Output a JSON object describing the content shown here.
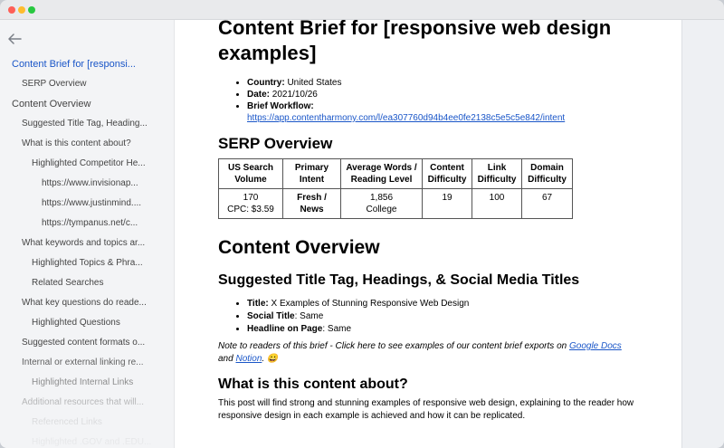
{
  "sidebar": {
    "items": [
      {
        "label": "Content Brief for [responsi...",
        "level": 0,
        "active": true
      },
      {
        "label": "SERP Overview",
        "level": 1
      },
      {
        "label": "Content Overview",
        "level": 0
      },
      {
        "label": "Suggested Title Tag, Heading...",
        "level": 1
      },
      {
        "label": "What is this content about?",
        "level": 1
      },
      {
        "label": "Highlighted Competitor He...",
        "level": 2
      },
      {
        "label": "https://www.invisionap...",
        "level": 3
      },
      {
        "label": "https://www.justinmind....",
        "level": 3
      },
      {
        "label": "https://tympanus.net/c...",
        "level": 3
      },
      {
        "label": "What keywords and topics ar...",
        "level": 1
      },
      {
        "label": "Highlighted Topics & Phra...",
        "level": 2
      },
      {
        "label": "Related Searches",
        "level": 2
      },
      {
        "label": "What key questions do reade...",
        "level": 1
      },
      {
        "label": "Highlighted Questions",
        "level": 2
      },
      {
        "label": "Suggested content formats o...",
        "level": 1
      },
      {
        "label": "Internal or external linking re...",
        "level": 1
      },
      {
        "label": "Highlighted Internal Links",
        "level": 2
      },
      {
        "label": "Additional resources that will...",
        "level": 1
      },
      {
        "label": "Referenced Links",
        "level": 2
      },
      {
        "label": "Highlighted .GOV and .EDU...",
        "level": 2
      }
    ]
  },
  "doc": {
    "title": "Content Brief for [responsive web design examples]",
    "meta": {
      "country_label": "Country:",
      "country_value": "United States",
      "date_label": "Date:",
      "date_value": "2021/10/26",
      "workflow_label": "Brief Workflow:",
      "workflow_link": "https://app.contentharmony.com/l/ea307760d94b4ee0fe2138c5e5c5e842/intent"
    },
    "serp_heading": "SERP Overview",
    "serp_table": {
      "headers": [
        "US Search Volume",
        "Primary Intent",
        "Average Words / Reading Level",
        "Content Difficulty",
        "Link Difficulty",
        "Domain Difficulty"
      ],
      "row": {
        "volume": "170",
        "cpc": "CPC: $3.59",
        "intent_1": "Fresh /",
        "intent_2": "News",
        "words": "1,856",
        "level": "College",
        "content_difficulty": "19",
        "link_difficulty": "100",
        "domain_difficulty": "67"
      }
    },
    "content_overview_heading": "Content Overview",
    "titles_heading": "Suggested Title Tag, Headings, & Social Media Titles",
    "titles": {
      "title_label": "Title:",
      "title_value": "X Examples of Stunning Responsive Web Design",
      "social_label": "Social Title",
      "social_value": ": Same",
      "headline_label": "Headline on Page",
      "headline_value": ": Same"
    },
    "note": {
      "text": "Note to readers of this brief - Click here to see examples of our content brief exports on",
      "link_docs": "Google Docs",
      "and": "and",
      "link_notion": "Notion",
      "tail": ". 😀"
    },
    "about_heading": "What is this content about?",
    "about_body": "This post will find strong and stunning examples of responsive web design, explaining to the reader how responsive design in each example is achieved and how it can be replicated."
  }
}
